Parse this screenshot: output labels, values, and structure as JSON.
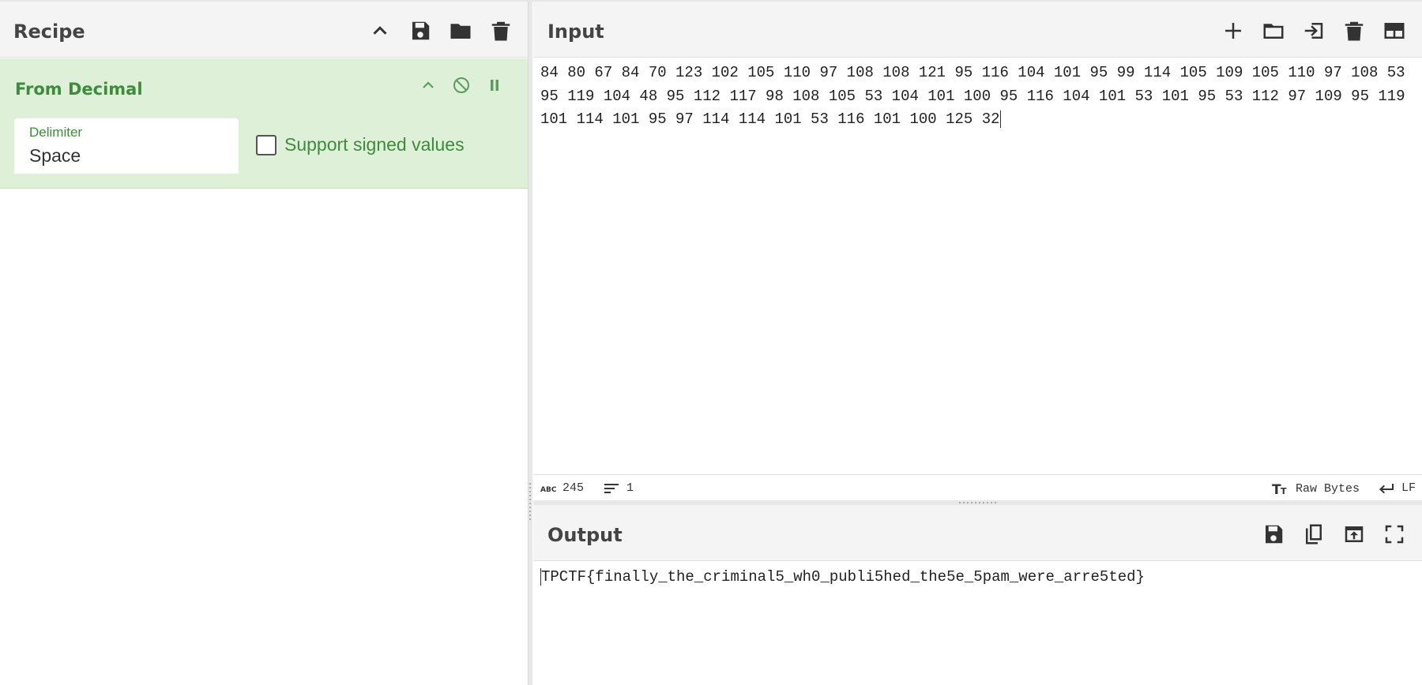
{
  "recipe": {
    "title": "Recipe",
    "icons": [
      "chevron-up-icon",
      "save-icon",
      "folder-icon",
      "trash-icon"
    ],
    "operation": {
      "name": "From Decimal",
      "delimiter_label": "Delimiter",
      "delimiter_value": "Space",
      "signed_label": "Support signed values",
      "signed_checked": false
    }
  },
  "input": {
    "title": "Input",
    "icons": [
      "plus-icon",
      "folder-icon",
      "input-arrow-icon",
      "trash-icon",
      "layout-icon"
    ],
    "text": "84 80 67 84 70 123 102 105 110 97 108 108 121 95 116 104 101 95 99 114 105 109 105 110 97 108 53 95 119 104 48 95 112 117 98 108 105 53 104 101 100 95 116 104 101 53 101 95 53 112 97 109 95 119 101 114 101 95 97 114 114 101 53 116 101 100 125 32",
    "status": {
      "length": "245",
      "lines": "1",
      "encoding": "Raw Bytes",
      "eol": "LF"
    }
  },
  "output": {
    "title": "Output",
    "icons": [
      "save-icon",
      "copy-icon",
      "replace-input-icon",
      "maximize-icon"
    ],
    "text": "TPCTF{finally_the_criminal5_wh0_publi5hed_the5e_5pam_were_arre5ted}"
  },
  "colors": {
    "accent_green": "#3c8c3c",
    "operation_bg": "#dff0d8",
    "header_bg": "#f4f4f4"
  }
}
